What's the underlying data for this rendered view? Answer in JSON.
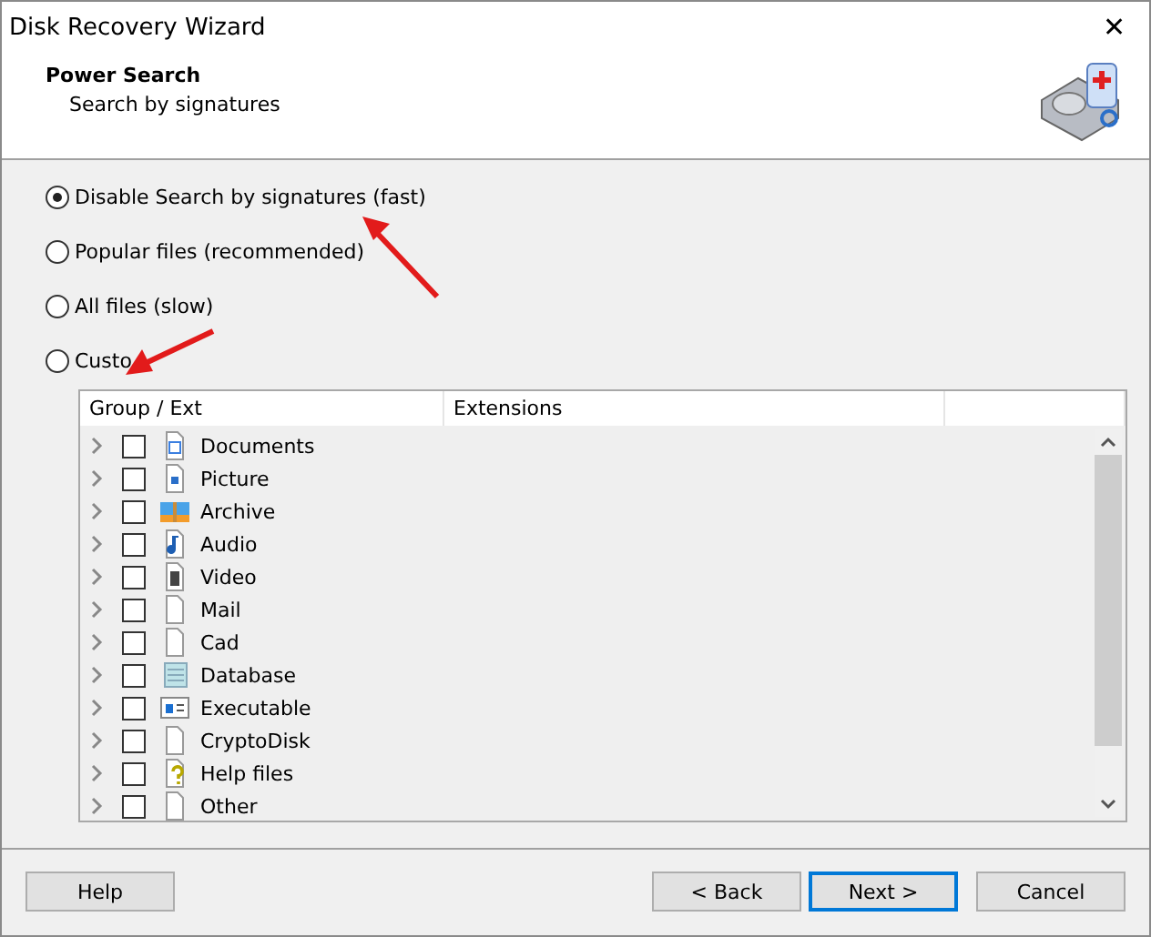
{
  "window": {
    "title": "Disk Recovery Wizard",
    "close": "✕"
  },
  "header": {
    "title": "Power Search",
    "subtitle": "Search by signatures"
  },
  "options": [
    {
      "label": "Disable Search by signatures (fast)",
      "selected": true
    },
    {
      "label": "Popular files (recommended)",
      "selected": false
    },
    {
      "label": "All files (slow)",
      "selected": false
    },
    {
      "label": "Custo",
      "selected": false
    }
  ],
  "table": {
    "columns": [
      "Group / Ext",
      "Extensions"
    ],
    "rows": [
      {
        "name": "Documents",
        "checked": false
      },
      {
        "name": "Picture",
        "checked": false
      },
      {
        "name": "Archive",
        "checked": false
      },
      {
        "name": "Audio",
        "checked": false
      },
      {
        "name": "Video",
        "checked": false
      },
      {
        "name": "Mail",
        "checked": false
      },
      {
        "name": "Cad",
        "checked": false
      },
      {
        "name": "Database",
        "checked": false
      },
      {
        "name": "Executable",
        "checked": false
      },
      {
        "name": "CryptoDisk",
        "checked": false
      },
      {
        "name": "Help files",
        "checked": false
      },
      {
        "name": "Other",
        "checked": false
      }
    ]
  },
  "buttons": [
    {
      "label": "Help",
      "default": false
    },
    {
      "label": "< Back",
      "default": false
    },
    {
      "label": "Next >",
      "default": true
    },
    {
      "label": "Cancel",
      "default": false
    }
  ]
}
